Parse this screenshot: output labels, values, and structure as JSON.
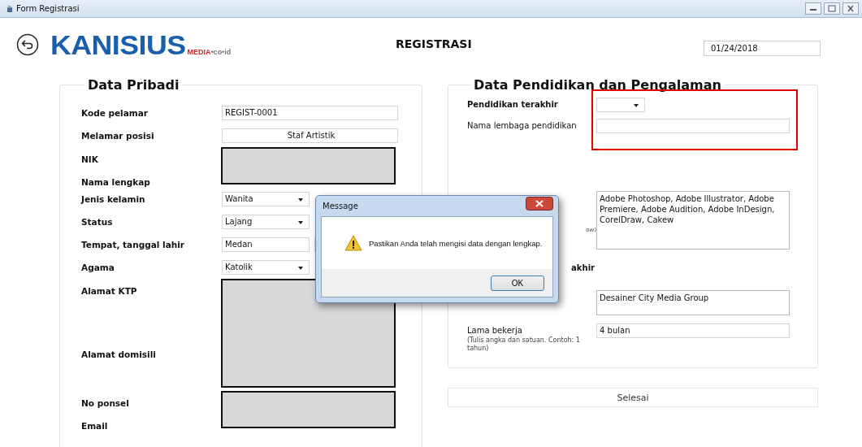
{
  "window": {
    "title": "Form Registrasi"
  },
  "header": {
    "logo": {
      "main": "KANISIUS",
      "sub": "MEDIA",
      "suffix": "•co•id"
    },
    "title": "REGISTRASI",
    "date": "01/24/2018"
  },
  "personal": {
    "legend": "Data Pribadi",
    "groups": [
      {
        "kind": "row",
        "label": "Kode pelamar",
        "field": {
          "kind": "text",
          "value": "REGIST-0001"
        }
      },
      {
        "kind": "row",
        "label": "Melamar posisi",
        "field": {
          "kind": "centered",
          "value": "Staf Artistik"
        }
      },
      {
        "kind": "redacted",
        "labels": [
          "NIK",
          "Nama lengkap"
        ]
      },
      {
        "kind": "row",
        "label": "Jenis kelamin",
        "field": {
          "kind": "select",
          "value": "Wanita"
        }
      },
      {
        "kind": "row",
        "label": "Status",
        "field": {
          "kind": "select",
          "value": "Lajang"
        }
      },
      {
        "kind": "row",
        "label": "Tempat, tanggal lahir",
        "field": {
          "kind": "place-date",
          "value": "Medan"
        }
      },
      {
        "kind": "row",
        "label": "Agama",
        "field": {
          "kind": "select",
          "value": "Katolik"
        }
      },
      {
        "kind": "redacted-large",
        "labels": [
          "Alamat KTP",
          "Alamat domisili"
        ]
      },
      {
        "kind": "redacted",
        "labels": [
          "No ponsel",
          "Email"
        ]
      }
    ]
  },
  "education": {
    "legend": "Data Pendidikan dan Pengalaman",
    "sections": [
      {
        "highlighted": true,
        "rows": [
          {
            "label": "Pendidikan terakhir",
            "bold": true,
            "kind": "select"
          },
          {
            "label": "Nama lembaga pendidikan",
            "bold": false,
            "kind": "text"
          }
        ]
      },
      {
        "highlighted": false,
        "rows": [
          {
            "hint": "ow)",
            "kind": "textarea",
            "value": "Adobe Photoshop, Adobe Illustrator, Adobe Premiere, Adobe Audition, Adobe InDesign, CorelDraw, Cakew"
          },
          {
            "label": "akhir",
            "bold": true,
            "kind": "none"
          },
          {
            "kind": "textarea-short",
            "value": "Desainer City Media Group"
          },
          {
            "label": "Lama bekerja",
            "bold": false,
            "hint": "(Tulis angka dan satuan. Contoh: 1 tahun)",
            "kind": "text",
            "value": "4 bulan"
          }
        ]
      }
    ]
  },
  "finish_button": "Selesai",
  "dialog": {
    "title": "Message",
    "message": "Pastikan Anda telah mengisi data dengan lengkap.",
    "button": "OK"
  }
}
